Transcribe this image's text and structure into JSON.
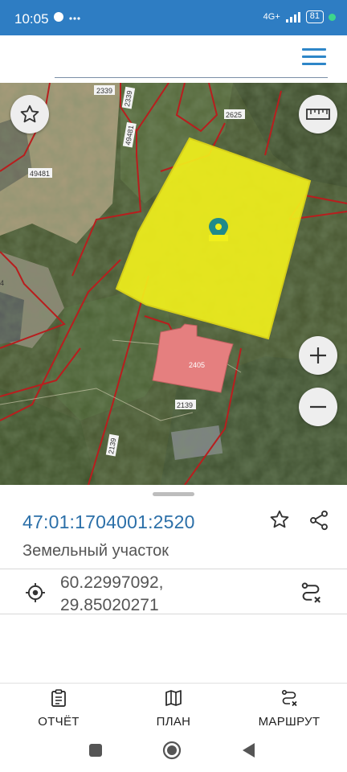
{
  "status_bar": {
    "time": "10:05",
    "network": "4G+",
    "battery": "81"
  },
  "map": {
    "parcel_labels": [
      "2339",
      "2339",
      "49481",
      "49481",
      "2625",
      "2405",
      "2139",
      "2139",
      "4"
    ],
    "selected_fill_color": "#f0ef1c",
    "building_color": "#e57f7f",
    "boundary_color": "#b81e1e",
    "icons": [
      "star-outline-icon",
      "ruler-icon",
      "zoom-in-icon",
      "zoom-out-icon",
      "location-pin-icon"
    ]
  },
  "info_panel": {
    "cadastral_number": "47:01:1704001:2520",
    "object_type": "Земельный участок",
    "coordinates_line1": "60.22997092,",
    "coordinates_line2": "29.85020271"
  },
  "bottom_nav": {
    "report_label": "ОТЧЁТ",
    "plan_label": "ПЛАН",
    "route_label": "МАРШРУТ"
  },
  "colors": {
    "accent": "#2e7dc3",
    "link": "#2b6fa8"
  }
}
